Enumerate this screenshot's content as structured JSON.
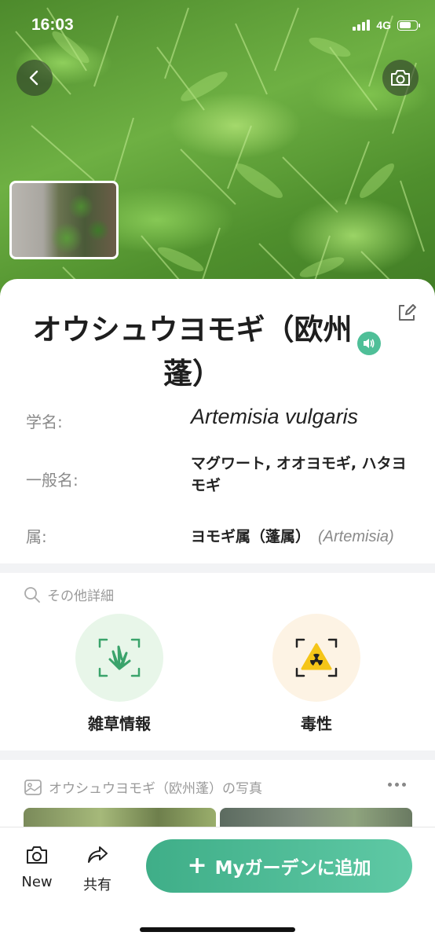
{
  "status_bar": {
    "time": "16:03",
    "network": "4G"
  },
  "plant": {
    "title": "オウシュウヨモギ（欧州蓬）",
    "scientific_name_label": "学名:",
    "scientific_name": "Artemisia vulgaris",
    "common_names_label": "一般名:",
    "common_names": "マグワート, オオヨモギ, ハタヨモギ",
    "genus_label": "属:",
    "genus": "ヨモギ属（蓬属）",
    "genus_latin": "(Artemisia)"
  },
  "details": {
    "heading": "その他詳細",
    "features": [
      {
        "label": "雑草情報",
        "icon": "weed-grass-icon",
        "bg": "#e8f6e9"
      },
      {
        "label": "毒性",
        "icon": "toxic-warning-icon",
        "bg": "#fdf3e4"
      }
    ]
  },
  "photos": {
    "heading": "オウシュウヨモギ（欧州蓬）の写真"
  },
  "bottom_bar": {
    "new_label": "New",
    "share_label": "共有",
    "add_button_label": "Myガーデンに追加"
  },
  "colors": {
    "accent": "#4fbf98",
    "accent_dark": "#3fae88"
  }
}
